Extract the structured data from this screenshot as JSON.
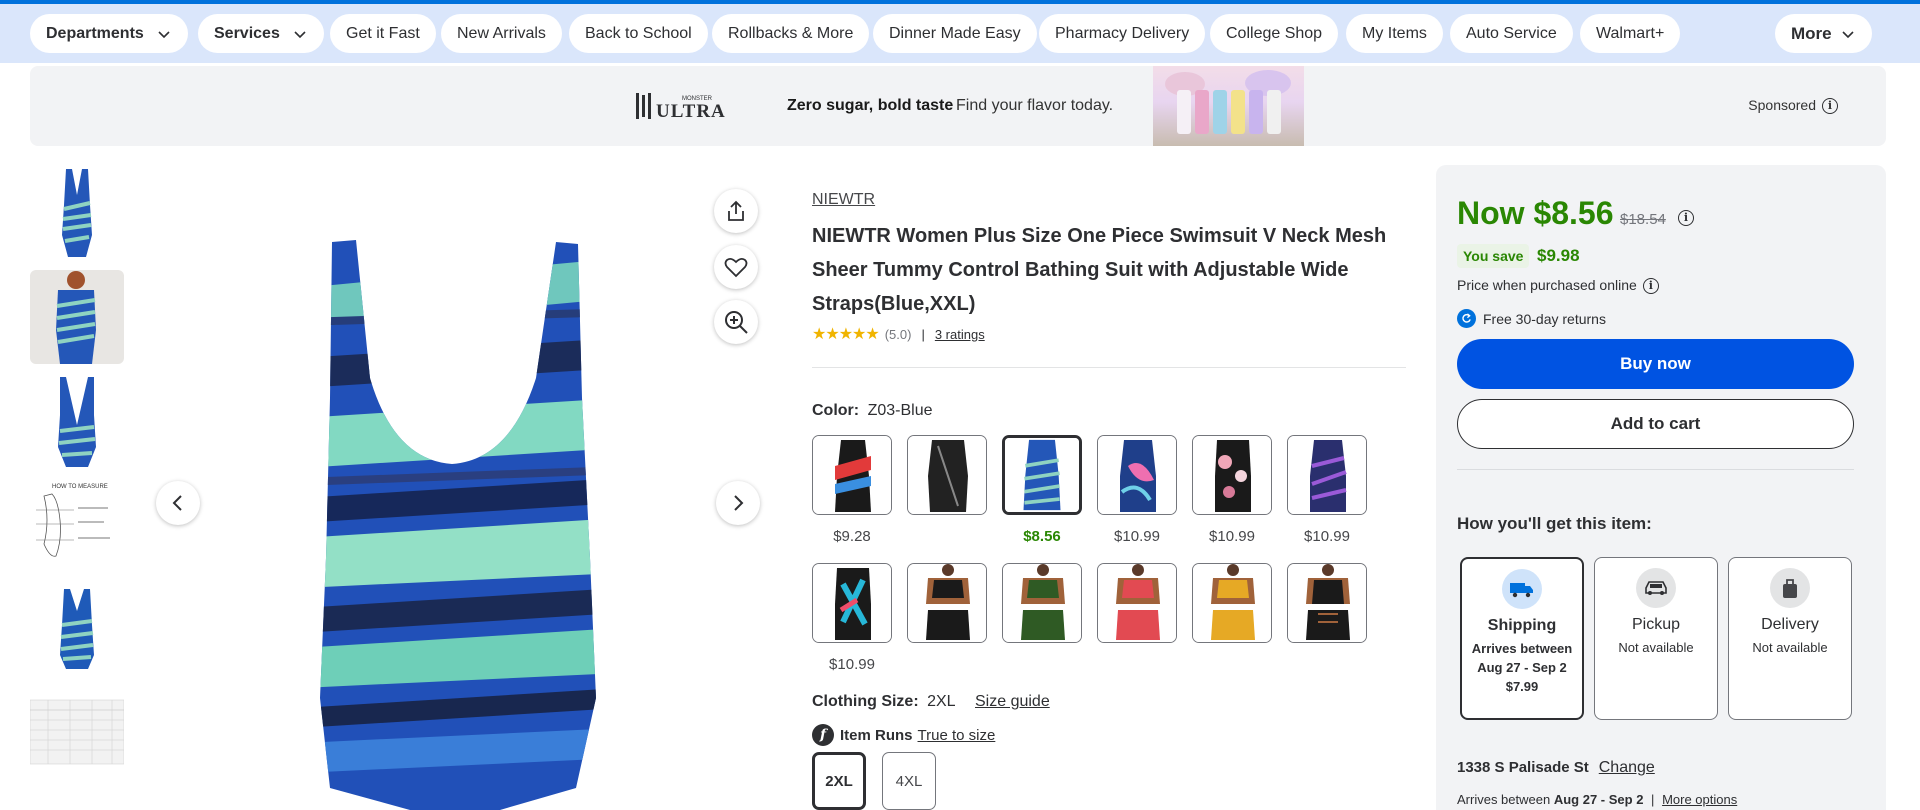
{
  "nav": {
    "departments": "Departments",
    "services": "Services",
    "links": [
      "Get it Fast",
      "New Arrivals",
      "Back to School",
      "Rollbacks & More",
      "Dinner Made Easy",
      "Pharmacy Delivery",
      "College Shop",
      "My Items",
      "Auto Service",
      "Walmart+"
    ],
    "more": "More"
  },
  "banner": {
    "logo_text": "ULTRA",
    "logo_small": "MONSTER",
    "headline": "Zero sugar, bold taste",
    "text": "Find your flavor today.",
    "sponsored": "Sponsored"
  },
  "gallery": {
    "thumb_measure_title": "HOW TO MEASURE"
  },
  "product": {
    "brand": "NIEWTR",
    "title": "NIEWTR Women Plus Size One Piece Swimsuit V Neck Mesh Sheer Tummy Control Bathing Suit with Adjustable Wide Straps(Blue,XXL)",
    "rating_value": 5,
    "rating_text": "(5.0)",
    "separator": "|",
    "ratings_link": "3 ratings",
    "color_label": "Color:",
    "color_value": "Z03-Blue",
    "swatch_prices": [
      "$9.28",
      "",
      "$8.56",
      "$10.99",
      "$10.99",
      "$10.99",
      "$10.99"
    ],
    "size_label": "Clothing Size:",
    "size_value": "2XL",
    "size_guide": "Size guide",
    "item_runs_label": "Item Runs",
    "item_runs_value": "True to size",
    "sizes": [
      "2XL",
      "4XL"
    ]
  },
  "buybox": {
    "now_price": "Now $8.56",
    "was_price": "$18.54",
    "you_save_label": "You save",
    "you_save_amount": "$9.98",
    "online_note": "Price when purchased online",
    "returns": "Free 30-day returns",
    "buy_now": "Buy now",
    "add_to_cart": "Add to cart",
    "how_heading": "How you'll get this item:",
    "options": [
      {
        "title": "Shipping",
        "line1": "Arrives between",
        "line2": "Aug 27 - Sep 2",
        "line3": "$7.99"
      },
      {
        "title": "Pickup",
        "line1": "Not available",
        "line2": "",
        "line3": ""
      },
      {
        "title": "Delivery",
        "line1": "Not available",
        "line2": "",
        "line3": ""
      }
    ],
    "address": "1338 S Palisade St",
    "change": "Change",
    "arrives_prefix": "Arrives between",
    "arrives_dates": "Aug 27 - Sep 2",
    "more_options": "More options"
  },
  "colors": {
    "nav_bg": "#dae6fb",
    "accent_blue": "#0053e2",
    "price_green": "#2a8703",
    "star": "#f0b400"
  }
}
